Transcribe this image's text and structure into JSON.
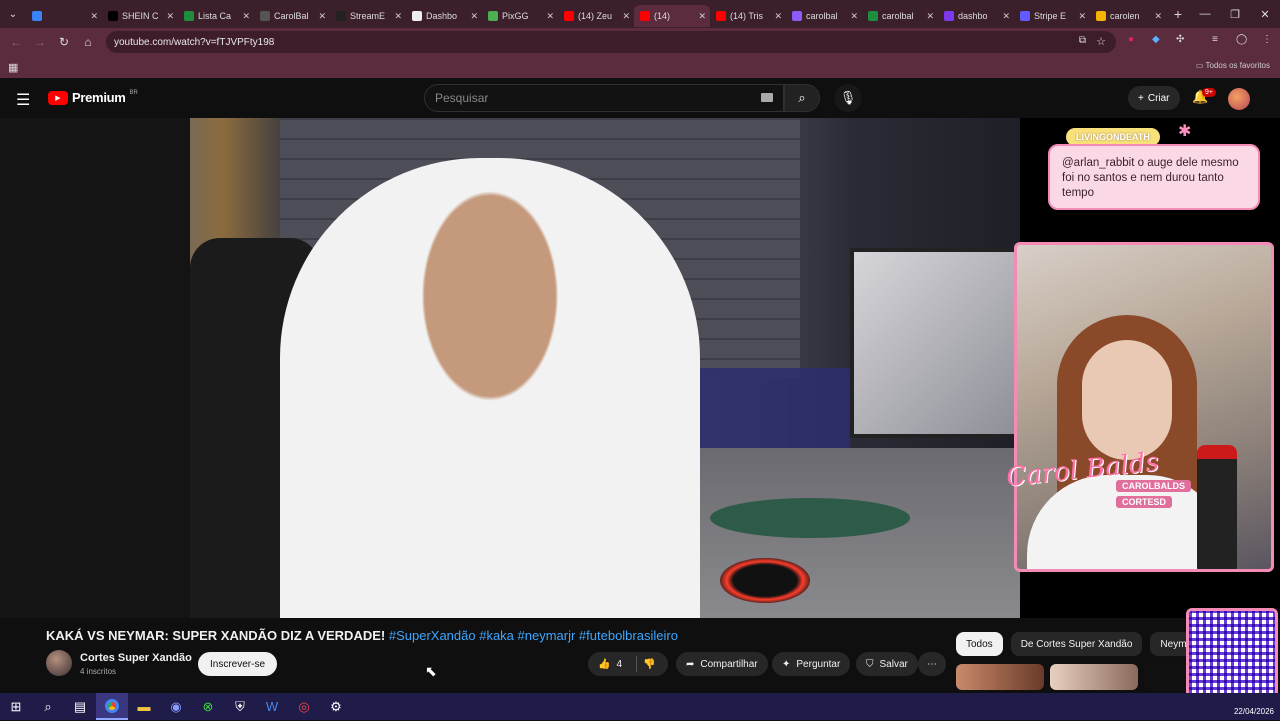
{
  "browser": {
    "tabs": [
      {
        "title": "",
        "color": "#3b82f6"
      },
      {
        "title": "SHEIN C",
        "color": "#000000"
      },
      {
        "title": "Lista Ca",
        "color": "#1e8e3e"
      },
      {
        "title": "CarolBal",
        "color": "#555555"
      },
      {
        "title": "StreamE",
        "color": "#222222"
      },
      {
        "title": "Dashbo",
        "color": "#eeeeee"
      },
      {
        "title": "PixGG",
        "color": "#4caf50"
      },
      {
        "title": "(14) Zeu",
        "color": "#ff0000"
      },
      {
        "title": "(14)",
        "color": "#ff0000",
        "active": true
      },
      {
        "title": "(14) Tris",
        "color": "#ff0000"
      },
      {
        "title": "carolbal",
        "color": "#8b5cf6"
      },
      {
        "title": "carolbal",
        "color": "#1e8e3e"
      },
      {
        "title": "dashbo",
        "color": "#7c3aed"
      },
      {
        "title": "Stripe E",
        "color": "#635bff"
      },
      {
        "title": "carolen",
        "color": "#f4b400"
      }
    ],
    "url": "youtube.com/watch?v=fTJVPFty198",
    "bookmarks_all": "Todos os favoritos"
  },
  "youtube": {
    "logo_text": "Premium",
    "country": "BR",
    "search_placeholder": "Pesquisar",
    "create_label": "Criar",
    "notif_count": "9+"
  },
  "overlay": {
    "chat_user": "LIVINGONDEATH",
    "chat_message": "@arlan_rabbit o auge dele mesmo foi no santos e nem durou tanto tempo",
    "brand_name": "Carol Balds",
    "social_handle": "CAROLBALDS",
    "social_handle2": "CORTESD"
  },
  "video": {
    "title_main": "KAKÁ VS NEYMAR: SUPER XANDÃO DIZ A VERDADE!",
    "title_tags": "#SuperXandão #kaka #neymarjr #futebolbrasileiro",
    "channel": "Cortes Super Xandão",
    "subscribers": "4 inscritos",
    "subscribe_label": "Inscrever-se",
    "likes": "4",
    "share_label": "Compartilhar",
    "ask_label": "Perguntar",
    "save_label": "Salvar"
  },
  "chips": [
    "Todos",
    "De Cortes Super Xandão",
    "Neymar"
  ],
  "taskbar": {
    "date": "22/04/2026"
  }
}
